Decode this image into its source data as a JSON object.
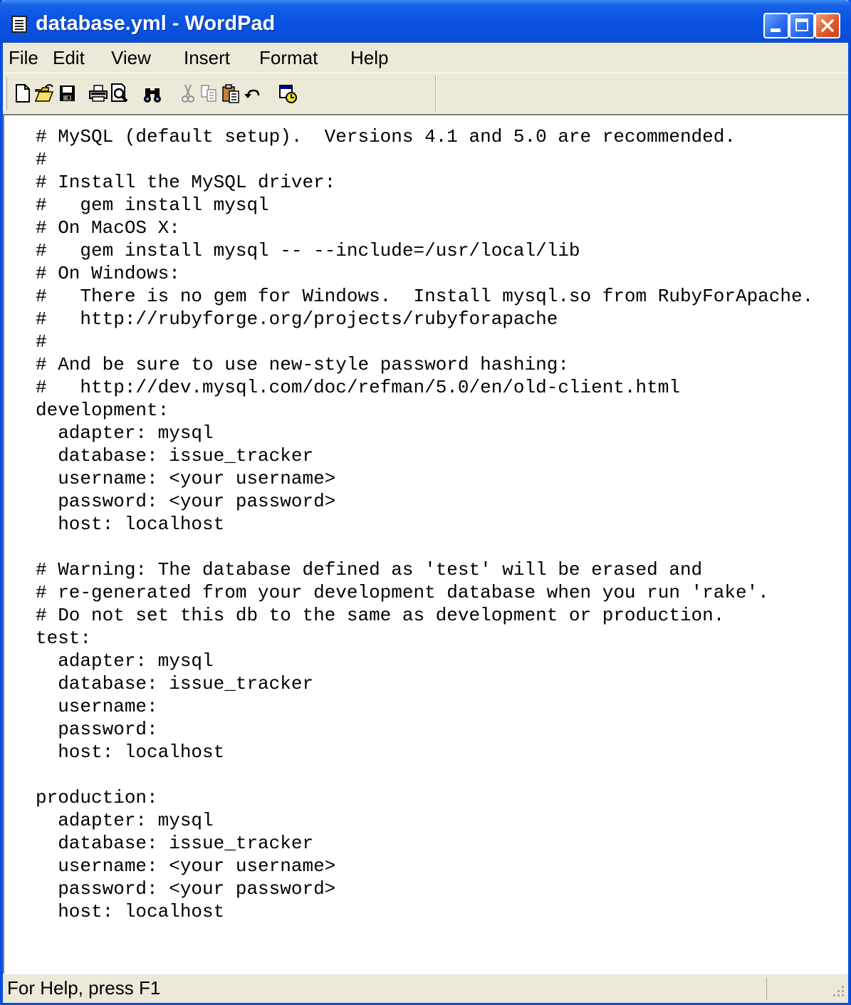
{
  "window": {
    "title": "database.yml - WordPad",
    "colors": {
      "titlebar": "#0a54e2",
      "frame": "#0a4ee0",
      "face": "#ece9d8",
      "close": "#e05a2a"
    }
  },
  "menu": [
    "File",
    "Edit",
    "View",
    "Insert",
    "Format",
    "Help"
  ],
  "toolbar": [
    "new-icon",
    "open-icon",
    "save-icon",
    "print-icon",
    "print-preview-icon",
    "find-icon",
    "cut-icon",
    "copy-icon",
    "paste-icon",
    "undo-icon",
    "date-time-icon"
  ],
  "document": {
    "lines": [
      "# MySQL (default setup).  Versions 4.1 and 5.0 are recommended.",
      "#",
      "# Install the MySQL driver:",
      "#   gem install mysql",
      "# On MacOS X:",
      "#   gem install mysql -- --include=/usr/local/lib",
      "# On Windows:",
      "#   There is no gem for Windows.  Install mysql.so from RubyForApache.",
      "#   http://rubyforge.org/projects/rubyforapache",
      "#",
      "# And be sure to use new-style password hashing:",
      "#   http://dev.mysql.com/doc/refman/5.0/en/old-client.html",
      "development:",
      "  adapter: mysql",
      "  database: issue_tracker",
      "  username: <your username>",
      "  password: <your password>",
      "  host: localhost",
      "",
      "# Warning: The database defined as 'test' will be erased and",
      "# re-generated from your development database when you run 'rake'.",
      "# Do not set this db to the same as development or production.",
      "test:",
      "  adapter: mysql",
      "  database: issue_tracker",
      "  username:",
      "  password:",
      "  host: localhost",
      "",
      "production:",
      "  adapter: mysql",
      "  database: issue_tracker",
      "  username: <your username>",
      "  password: <your password>",
      "  host: localhost"
    ]
  },
  "status": {
    "text": "For Help, press F1"
  }
}
